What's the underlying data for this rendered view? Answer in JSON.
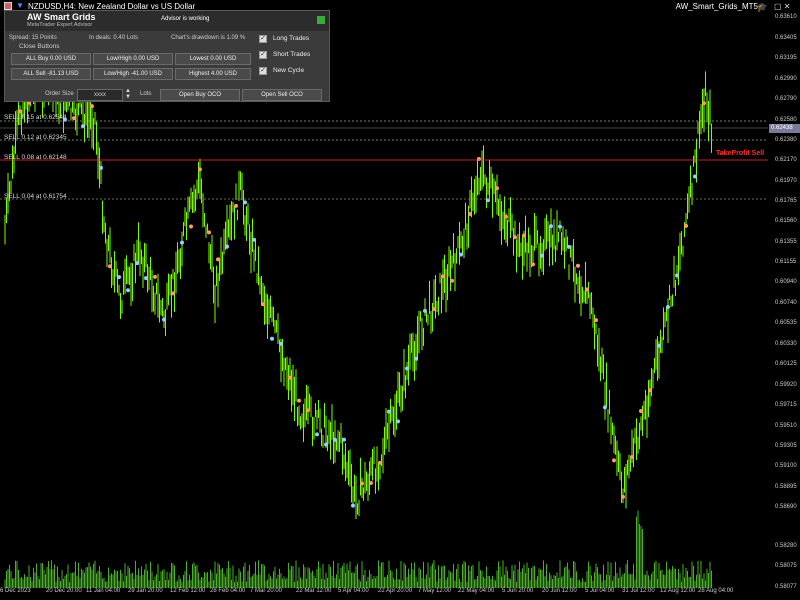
{
  "window": {
    "symbol_title": "NZDUSD,H4:  New Zealand Dollar vs US Dollar",
    "ea_name": "AW_Smart_Grids_MT5"
  },
  "panel": {
    "title": "AW Smart Grids",
    "subtitle": "MetaTrader Expert Advisor",
    "status": "Advisor is working",
    "spread": "Spread: 15 Points",
    "in_deals": "In deals: 0.40 Lots",
    "drawdown": "Chart's drawdown is 1.09 %",
    "close_buttons_label": "Close Buttons",
    "buttons": {
      "all_buy": "ALL Buy 0.00 USD",
      "low_high": "Low/High 0.00 USD",
      "lowest": "Lowest 0.00 USD",
      "all_sell": "ALL Sell -81.13 USD",
      "low_high_sell": "Low/High -41.00 USD",
      "highest": "Highest 4.00 USD"
    },
    "checks": [
      {
        "label": "Long Trades",
        "checked": true
      },
      {
        "label": "Short Trades",
        "checked": true
      },
      {
        "label": "New Cycle",
        "checked": true
      }
    ],
    "order_size_label": "Order Size",
    "order_size_value": "xxxx",
    "lots_label": "Lots",
    "open_buy_oco": "Open Buy OCO",
    "open_sell_oco": "Open Sell OCO"
  },
  "levels": [
    {
      "label": "SELL 0.15 at 0.62544",
      "price": 0.62544,
      "color": "#8fae8f"
    },
    {
      "label": "SELL 0.12 at 0.62345",
      "price": 0.62345,
      "color": "#8fae8f"
    },
    {
      "label": "SELL 0.08 at 0.62148",
      "price": 0.62148,
      "color": "#ff3030"
    },
    {
      "label": "SELL 0.04 at 0.61754",
      "price": 0.61754,
      "color": "#a08c4a"
    }
  ],
  "take_profit_label": "TakeProfit Sell",
  "current_price": "0.62438",
  "y_axis": [
    "0.63610",
    "0.63405",
    "0.63195",
    "0.62990",
    "0.62790",
    "0.62580",
    "0.62380",
    "0.62170",
    "0.61970",
    "0.61765",
    "0.61560",
    "0.61355",
    "0.61155",
    "0.60940",
    "0.60740",
    "0.60535",
    "0.60330",
    "0.60125",
    "0.59920",
    "0.59715",
    "0.59510",
    "0.59305",
    "0.59100",
    "0.58895",
    "0.58690",
    "0.58280",
    "0.58075",
    "0.58077"
  ],
  "x_axis": [
    "6 Dec 2023",
    "20 Dec 20:00",
    "11 Jan 04:00",
    "29 Jan 20:00",
    "12 Feb 12:00",
    "28 Feb 04:00",
    "7 Mar 20:00",
    "22 Mar 12:00",
    "5 Apr 04:00",
    "22 Apr 20:00",
    "7 May 12:00",
    "22 May 04:00",
    "5 Jun 20:00",
    "20 Jun 12:00",
    "5 Jul 04:00",
    "31 Jul 12:00",
    "12 Aug 12:00",
    "28 Aug 04:00"
  ],
  "colors": {
    "candle": "#7cfc00",
    "volume": "#4caf2a",
    "grid": "#1a1a1a"
  }
}
